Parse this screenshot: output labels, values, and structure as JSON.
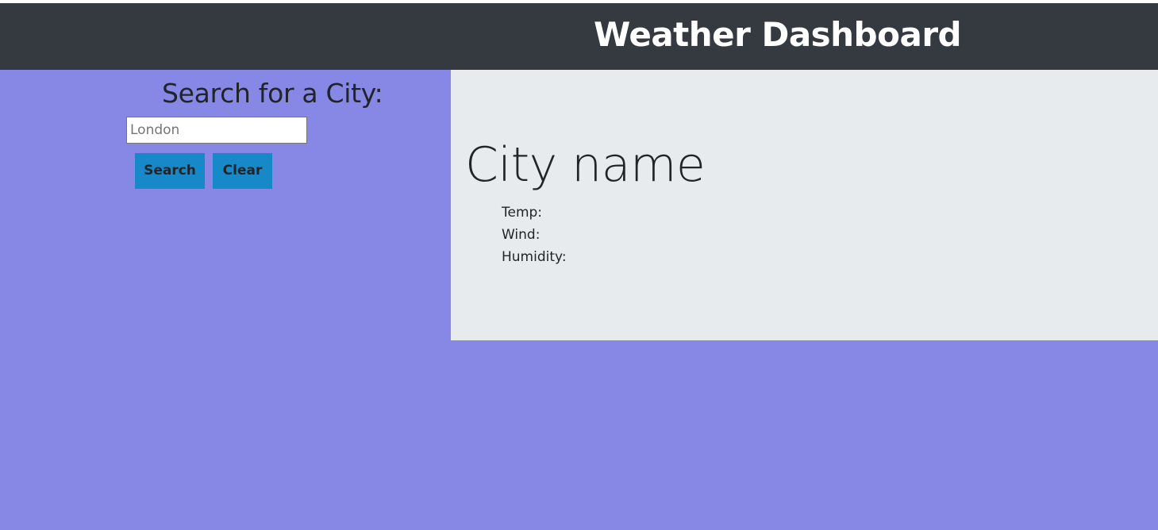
{
  "header": {
    "title": "Weather Dashboard"
  },
  "sidebar": {
    "heading": "Search for a City:",
    "search_placeholder": "London",
    "search_label": "Search",
    "clear_label": "Clear"
  },
  "current": {
    "city_name": "City name",
    "temp_label": "Temp:",
    "wind_label": "Wind:",
    "humidity_label": "Humidity:"
  },
  "colors": {
    "header_bg": "#343a40",
    "page_bg": "#8787e6",
    "card_bg": "#e8ebee",
    "button_bg": "#1788c8"
  }
}
